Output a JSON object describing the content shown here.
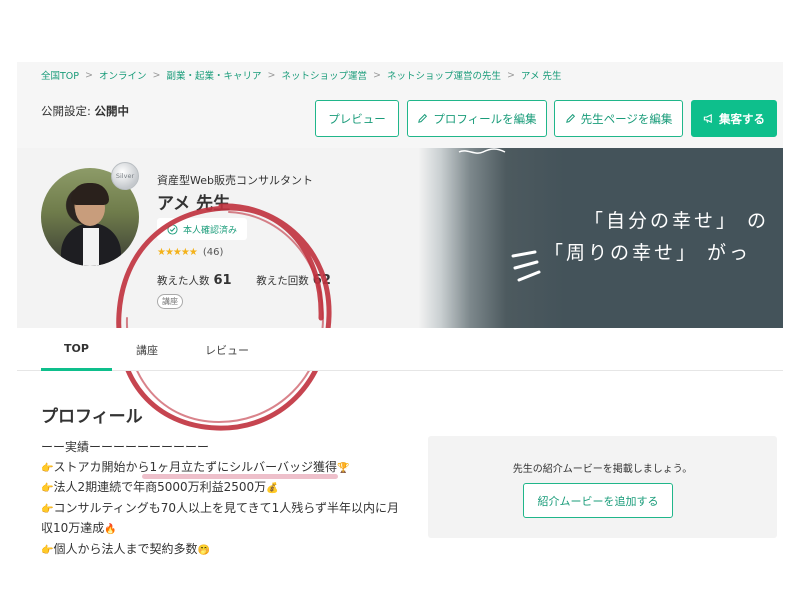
{
  "breadcrumb": [
    "全国TOP",
    "オンライン",
    "副業・起業・キャリア",
    "ネットショップ運営",
    "ネットショップ運営の先生",
    "アメ 先生"
  ],
  "topbar": {
    "status_label": "公開設定: ",
    "status_value": "公開中",
    "preview_label": "プレビュー",
    "edit_profile_label": "プロフィールを編集",
    "edit_page_label": "先生ページを編集",
    "promote_label": "集客する"
  },
  "teacher": {
    "title": "資産型Web販売コンサルタント",
    "name": "アメ 先生",
    "verified_label": "本人確認済み",
    "badge_label": "Silver",
    "stars": "★★★★★",
    "review_count": "(46)",
    "students_label": "教えた人数",
    "students_value": "61",
    "lessons_label": "教えた回数",
    "lessons_value": "62",
    "tag": "講座"
  },
  "cover": {
    "line1": "「自分の幸せ」 の",
    "line2": "「周りの幸せ」 がっ"
  },
  "tabs": [
    {
      "label": "TOP",
      "active": true
    },
    {
      "label": "講座",
      "active": false
    },
    {
      "label": "レビュー",
      "active": false
    }
  ],
  "profile": {
    "heading": "プロフィール",
    "lines": [
      {
        "emoji": "",
        "text": "ーー実績ーーーーーーーーーー",
        "suffix": ""
      },
      {
        "emoji": "👉",
        "text": "ストアカ開始から1ヶ月立たずにシルバーバッジ獲得",
        "suffix": "🏆"
      },
      {
        "emoji": "👉",
        "text": "法人2期連続で年商5000万利益2500万",
        "suffix": "💰"
      },
      {
        "emoji": "👉",
        "text": "コンサルティングも70人以上を見てきて1人残らず半年以内に月",
        "suffix": ""
      },
      {
        "emoji": "",
        "text": "収10万達成",
        "suffix": "🔥"
      },
      {
        "emoji": "👉",
        "text": "個人から法人まで契約多数",
        "suffix": "🤭"
      }
    ]
  },
  "movie": {
    "text": "先生の紹介ムービーを掲載しましょう。",
    "button_label": "紹介ムービーを追加する"
  },
  "colors": {
    "accent": "#0ebf8c",
    "accent_text": "#1a9c7a",
    "annotation_red": "#c0313d",
    "cover_bg": "#44535a"
  }
}
